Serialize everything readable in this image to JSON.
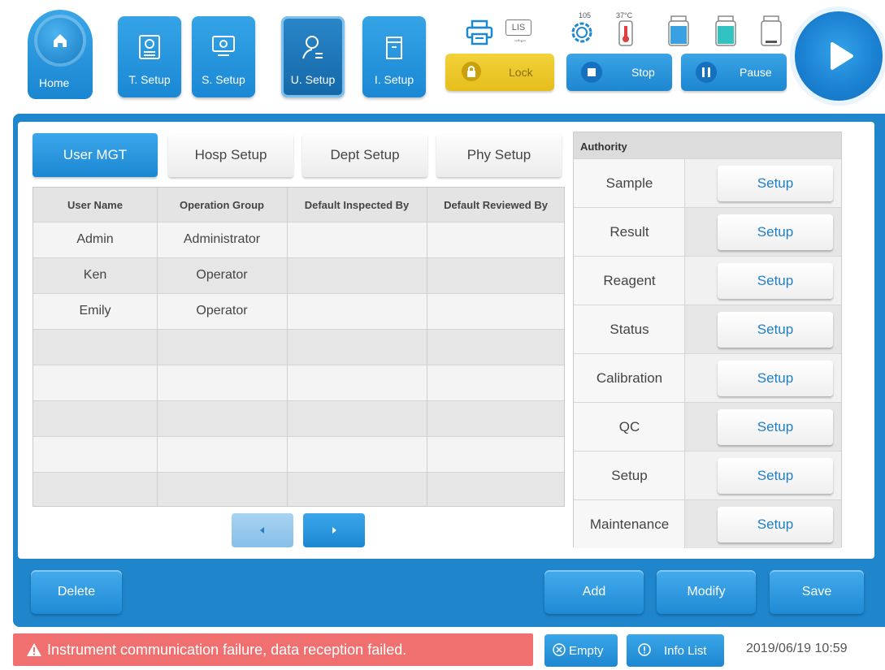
{
  "toolbar": {
    "home_label": "Home",
    "t_setup_label": "T. Setup",
    "s_setup_label": "S. Setup",
    "u_setup_label": "U. Setup",
    "i_setup_label": "I. Setup",
    "lis_label": "LIS",
    "gauge_value": "105",
    "temperature": "37°C",
    "lock_label": "Lock",
    "stop_label": "Stop",
    "pause_label": "Pause"
  },
  "tabs": [
    {
      "label": "User MGT",
      "active": true
    },
    {
      "label": "Hosp Setup",
      "active": false
    },
    {
      "label": "Dept Setup",
      "active": false
    },
    {
      "label": "Phy Setup",
      "active": false
    }
  ],
  "users_table": {
    "columns": [
      "User Name",
      "Operation Group",
      "Default Inspected By",
      "Default Reviewed By"
    ],
    "rows": [
      [
        "Admin",
        "Administrator",
        "",
        ""
      ],
      [
        "Ken",
        "Operator",
        "",
        ""
      ],
      [
        "Emily",
        "Operator",
        "",
        ""
      ],
      [
        "",
        "",
        "",
        ""
      ],
      [
        "",
        "",
        "",
        ""
      ],
      [
        "",
        "",
        "",
        ""
      ],
      [
        "",
        "",
        "",
        ""
      ],
      [
        "",
        "",
        "",
        ""
      ]
    ]
  },
  "authority": {
    "title": "Authority",
    "items": [
      {
        "name": "Sample",
        "button": "Setup"
      },
      {
        "name": "Result",
        "button": "Setup"
      },
      {
        "name": "Reagent",
        "button": "Setup"
      },
      {
        "name": "Status",
        "button": "Setup"
      },
      {
        "name": "Calibration",
        "button": "Setup"
      },
      {
        "name": "QC",
        "button": "Setup"
      },
      {
        "name": "Setup",
        "button": "Setup"
      },
      {
        "name": "Maintenance",
        "button": "Setup"
      }
    ]
  },
  "actions": {
    "delete_label": "Delete",
    "add_label": "Add",
    "modify_label": "Modify",
    "save_label": "Save"
  },
  "status_bar": {
    "alarm_text": "Instrument communication failure, data reception failed.",
    "empty_label": "Empty",
    "info_list_label": "Info List",
    "datetime": "2019/06/19 10:59"
  },
  "colors": {
    "primary": "#1f86cc",
    "lock": "#e9c62a",
    "alarm": "#f07070",
    "setup_text": "#1e7fc6"
  }
}
